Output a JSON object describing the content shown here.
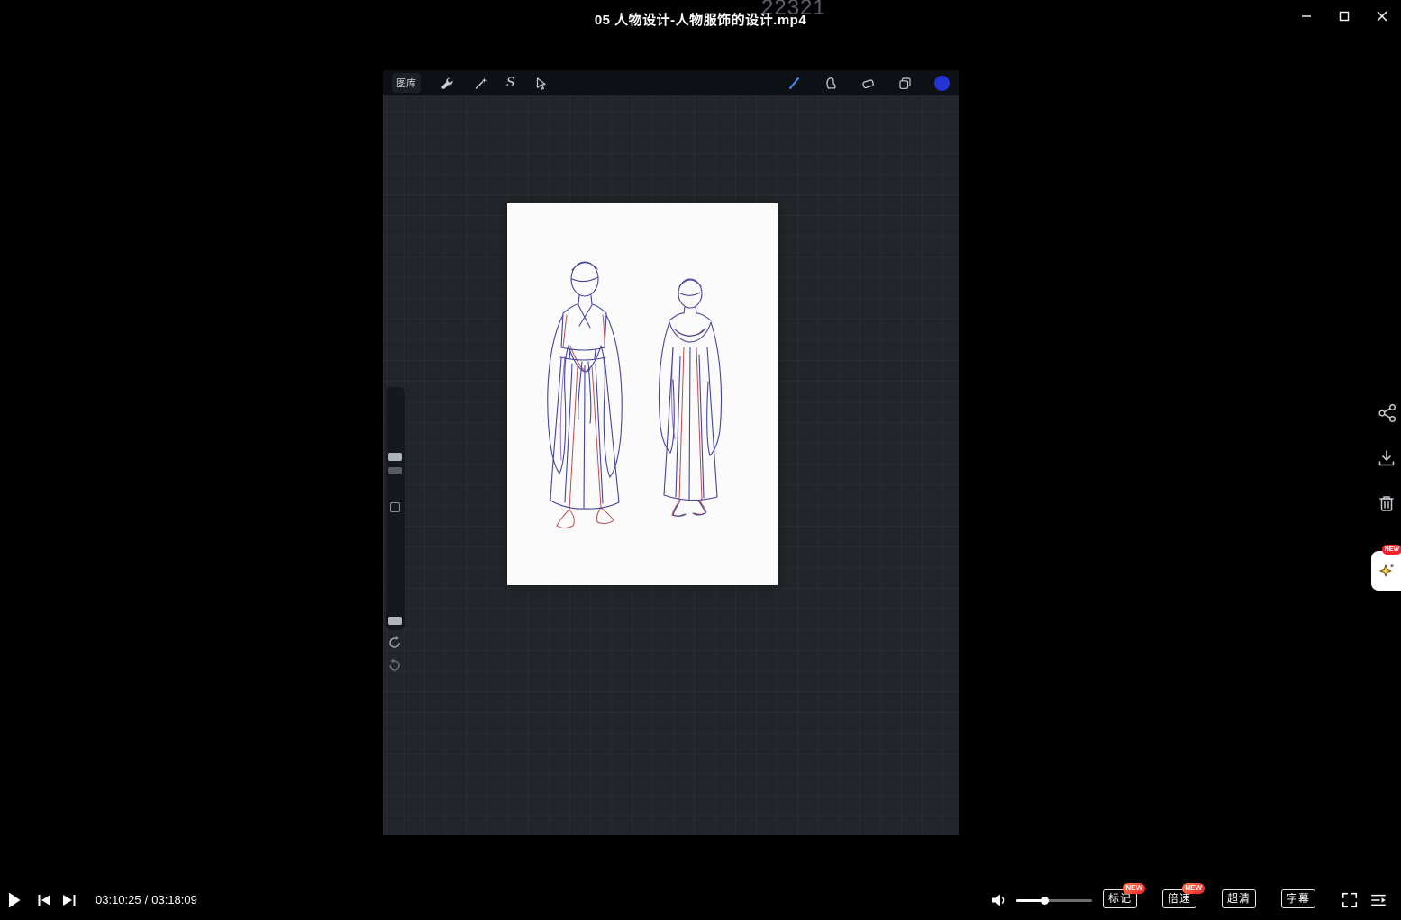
{
  "window": {
    "title": "05 人物设计-人物服饰的设计.mp4",
    "watermark": "22321"
  },
  "procreate": {
    "gallery": "图库",
    "selection": "S"
  },
  "player": {
    "current_time": "03:10:25",
    "separator": "/",
    "duration": "03:18:09",
    "mark": "标记",
    "speed": "倍速",
    "hd": "超清",
    "subtitle": "字幕",
    "badge_new": "NEW"
  },
  "side_panel": {
    "badge_new": "NEW"
  },
  "colors": {
    "active_color": "#2433d6",
    "badge_red": "#f5222d",
    "brush_selected": "#4d8df8"
  }
}
